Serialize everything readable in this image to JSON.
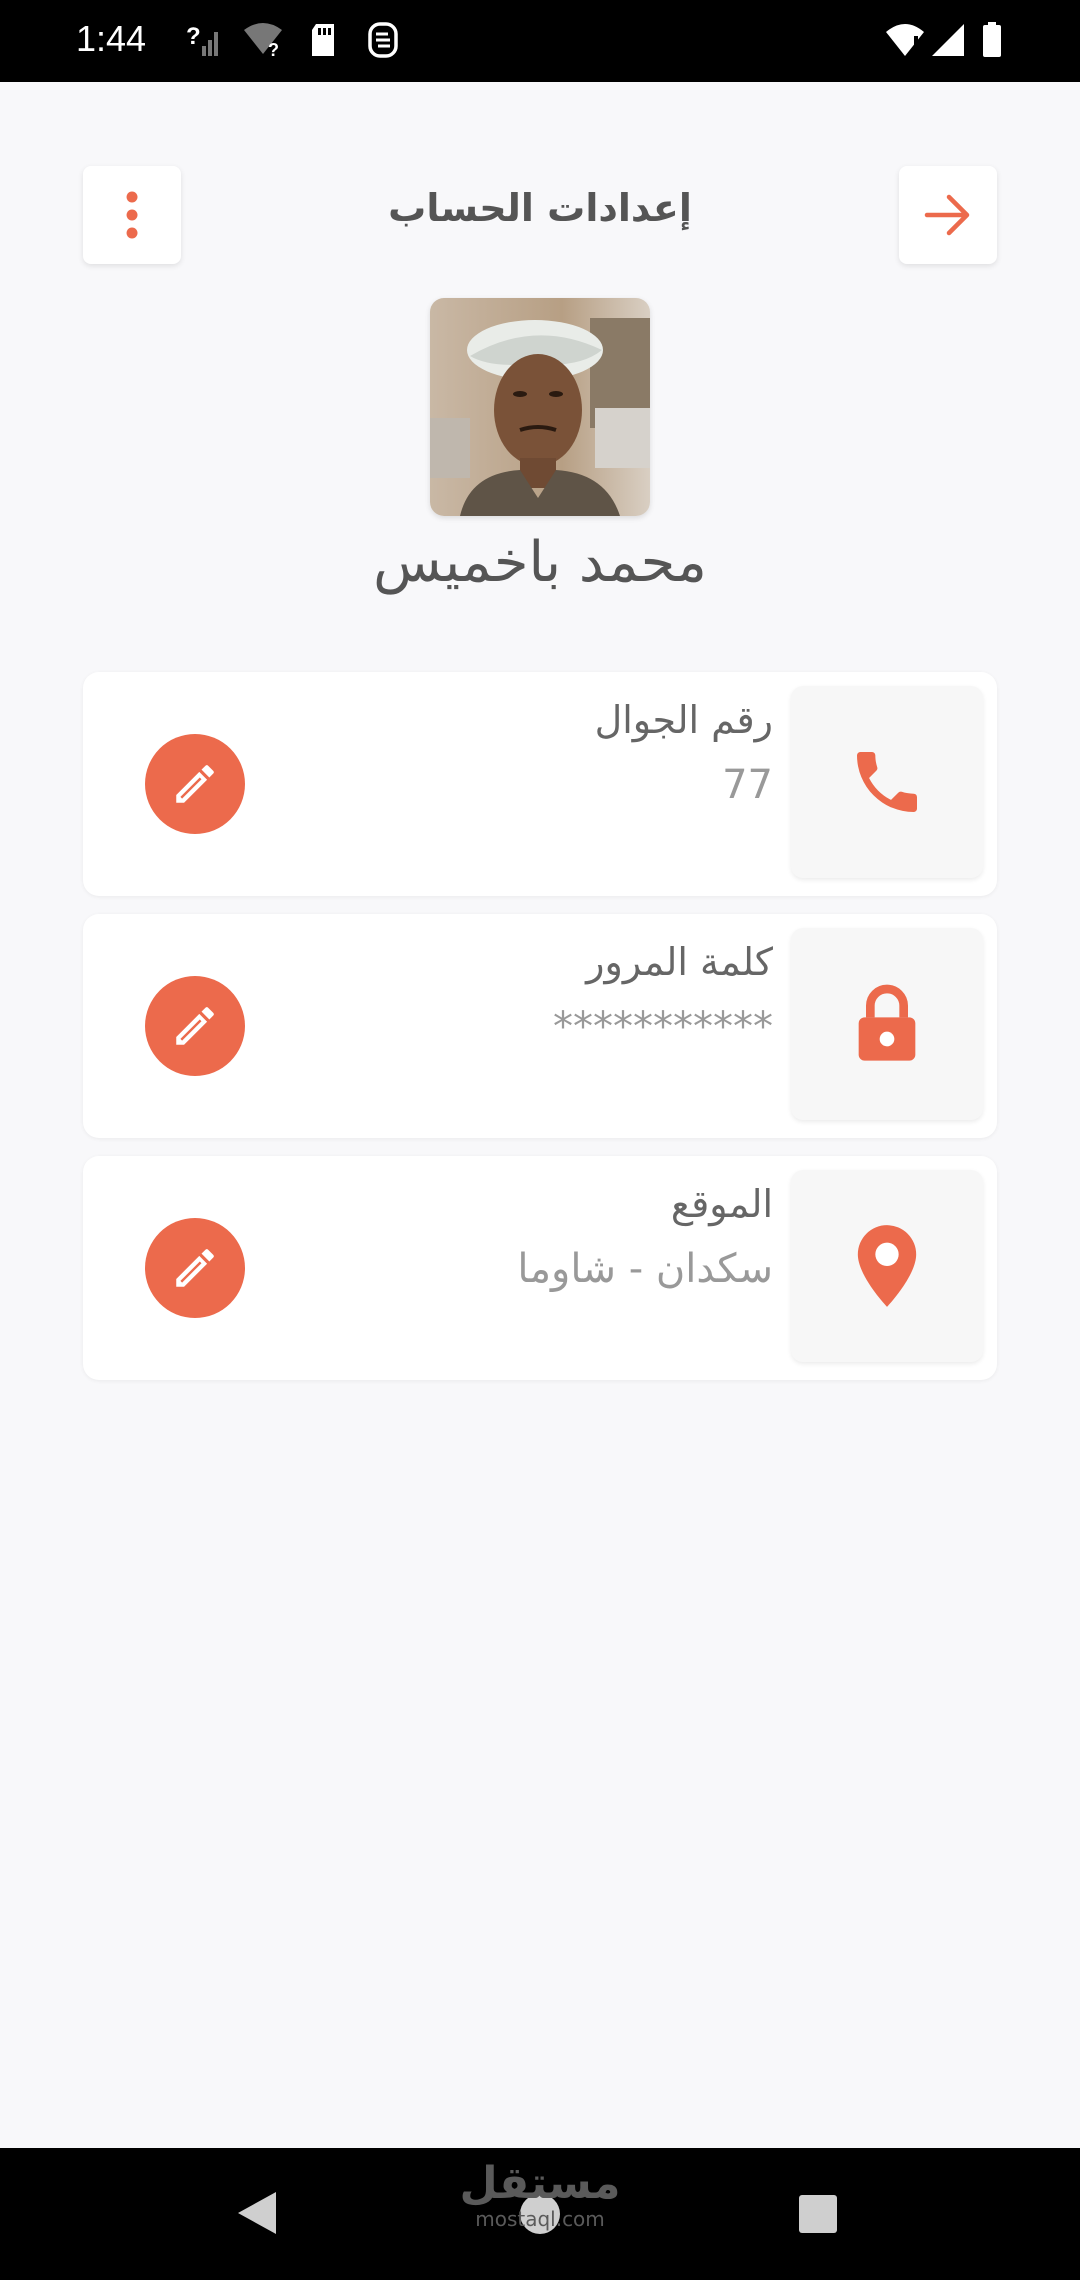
{
  "status_bar": {
    "time": "1:44",
    "icons": [
      "signal-unknown-icon",
      "wifi-unknown-icon",
      "sd-card-icon",
      "sync-icon",
      "wifi-icon",
      "cell-signal-icon",
      "battery-icon"
    ]
  },
  "header": {
    "title": "إعدادات الحساب",
    "menu_icon": "more-vert-icon",
    "back_icon": "arrow-forward-icon"
  },
  "profile": {
    "name": "محمد باخميس"
  },
  "cards": [
    {
      "label": "رقم الجوال",
      "value": "77",
      "icon": "phone-icon"
    },
    {
      "label": "كلمة المرور",
      "value": "***********",
      "icon": "lock-icon"
    },
    {
      "label": "الموقع",
      "value": "سكدان - شاوما",
      "icon": "location-pin-icon"
    }
  ],
  "watermark": {
    "arabic": "مستقل",
    "latin": "mostaql.com"
  },
  "colors": {
    "accent": "#EC6A4C",
    "background": "#F8F8FA",
    "card": "#FFFFFF",
    "icon_box": "#F7F7F7"
  }
}
